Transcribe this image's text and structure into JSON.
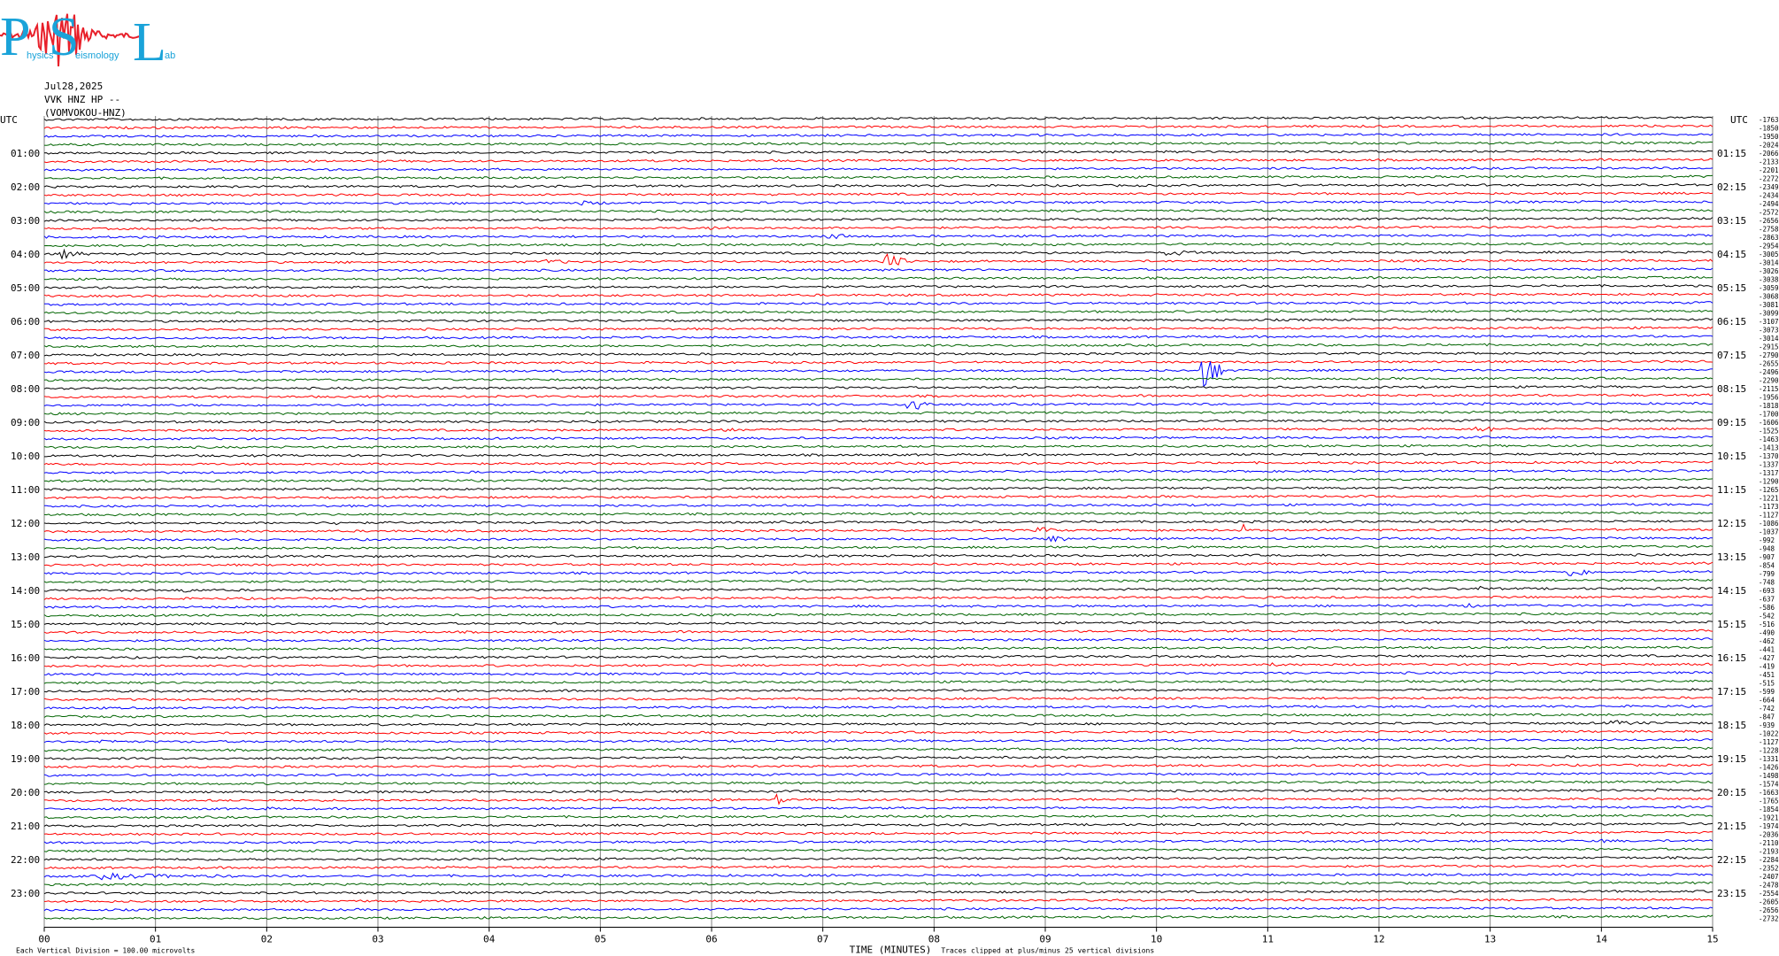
{
  "logo": {
    "letters": [
      "P",
      "S",
      "L"
    ],
    "subtext": [
      "hysics",
      "eismology",
      "ab"
    ],
    "colors": {
      "letters": "#1aa3d9",
      "wave": "#e8202a"
    }
  },
  "header": {
    "date": "Jul28,2025",
    "channel": "VVK HNZ HP --",
    "station": "(VOMVOKOU-HNZ)"
  },
  "chart_data": {
    "type": "line",
    "description_free": true,
    "left_label_header": "UTC",
    "right_label_header": "UTC",
    "left_hours": [
      "01:00",
      "02:00",
      "03:00",
      "04:00",
      "05:00",
      "06:00",
      "07:00",
      "08:00",
      "09:00",
      "10:00",
      "11:00",
      "12:00",
      "13:00",
      "14:00",
      "15:00",
      "16:00",
      "17:00",
      "18:00",
      "19:00",
      "20:00",
      "21:00",
      "22:00",
      "23:00"
    ],
    "right_hours": [
      "01:15",
      "02:15",
      "03:15",
      "04:15",
      "05:15",
      "06:15",
      "07:15",
      "08:15",
      "09:15",
      "10:15",
      "11:15",
      "12:15",
      "13:15",
      "14:15",
      "15:15",
      "16:15",
      "17:15",
      "18:15",
      "19:15",
      "20:15",
      "21:15",
      "22:15",
      "23:15"
    ],
    "right_values": [
      "-1763",
      "-1850",
      "-1950",
      "-2024",
      "-2066",
      "-2133",
      "-2201",
      "-2272",
      "-2349",
      "-2434",
      "-2494",
      "-2572",
      "-2656",
      "-2758",
      "-2863",
      "-2954",
      "-3005",
      "-3014",
      "-3026",
      "-3038",
      "-3059",
      "-3068",
      "-3081",
      "-3099",
      "-3107",
      "-3073",
      "-3014",
      "-2915",
      "-2790",
      "-2655",
      "-2496",
      "-2290",
      "-2115",
      "-1956",
      "-1818",
      "-1700",
      "-1606",
      "-1525",
      "-1463",
      "-1413",
      "-1370",
      "-1337",
      "-1317",
      "-1290",
      "-1265",
      "-1221",
      "-1173",
      "-1127",
      "-1086",
      "-1037",
      "-992",
      "-948",
      "-907",
      "-854",
      "-799",
      "-748",
      "-693",
      "-637",
      "-586",
      "-542",
      "-516",
      "-490",
      "-462",
      "-441",
      "-427",
      "-419",
      "-451",
      "-515",
      "-599",
      "-664",
      "-742",
      "-847",
      "-939",
      "-1022",
      "-1127",
      "-1228",
      "-1331",
      "-1426",
      "-1498",
      "-1574",
      "-1663",
      "-1765",
      "-1854",
      "-1921",
      "-1974",
      "-2036",
      "-2110",
      "-2193",
      "-2284",
      "-2352",
      "-2407",
      "-2478",
      "-2554",
      "-2605",
      "-2656",
      "-2732"
    ],
    "trace_colors": [
      "#000000",
      "#ff0000",
      "#0000ff",
      "#006400"
    ],
    "trace_minutes": 15,
    "traces_count": 96,
    "x_ticks": [
      "00",
      "01",
      "02",
      "03",
      "04",
      "05",
      "06",
      "07",
      "08",
      "09",
      "10",
      "11",
      "12",
      "13",
      "14",
      "15"
    ],
    "xlabel": "TIME (MINUTES)",
    "events": [
      {
        "trace": 16,
        "minute": 0.15,
        "amp": 0.5,
        "dur": 0.25
      },
      {
        "trace": 16,
        "minute": 10.1,
        "amp": 0.4,
        "dur": 0.3
      },
      {
        "trace": 17,
        "minute": 7.55,
        "amp": 1.2,
        "dur": 0.25
      },
      {
        "trace": 17,
        "minute": 4.5,
        "amp": 0.25,
        "dur": 0.3
      },
      {
        "trace": 14,
        "minute": 7.05,
        "amp": 0.35,
        "dur": 0.3
      },
      {
        "trace": 13,
        "minute": 6.0,
        "amp": 0.2,
        "dur": 0.2
      },
      {
        "trace": 10,
        "minute": 4.8,
        "amp": 0.2,
        "dur": 0.3
      },
      {
        "trace": 30,
        "minute": 10.42,
        "amp": 2.5,
        "dur": 0.25
      },
      {
        "trace": 34,
        "minute": 7.78,
        "amp": 1.5,
        "dur": 0.2
      },
      {
        "trace": 37,
        "minute": 12.9,
        "amp": 0.45,
        "dur": 0.2
      },
      {
        "trace": 37,
        "minute": 6.1,
        "amp": 0.2,
        "dur": 0.2
      },
      {
        "trace": 48,
        "minute": 2.6,
        "amp": 0.25,
        "dur": 0.2
      },
      {
        "trace": 49,
        "minute": 8.95,
        "amp": 0.5,
        "dur": 0.15
      },
      {
        "trace": 49,
        "minute": 10.78,
        "amp": 0.6,
        "dur": 0.08
      },
      {
        "trace": 50,
        "minute": 9.05,
        "amp": 0.45,
        "dur": 0.2
      },
      {
        "trace": 51,
        "minute": 10.12,
        "amp": 0.35,
        "dur": 0.1
      },
      {
        "trace": 54,
        "minute": 13.7,
        "amp": 0.6,
        "dur": 0.35
      },
      {
        "trace": 56,
        "minute": 1.25,
        "amp": 0.3,
        "dur": 0.15
      },
      {
        "trace": 56,
        "minute": 12.92,
        "amp": 0.35,
        "dur": 0.1
      },
      {
        "trace": 58,
        "minute": 12.8,
        "amp": 0.2,
        "dur": 0.2
      },
      {
        "trace": 65,
        "minute": 11.0,
        "amp": 0.15,
        "dur": 0.2
      },
      {
        "trace": 72,
        "minute": 14.1,
        "amp": 0.25,
        "dur": 0.3
      },
      {
        "trace": 74,
        "minute": 0.5,
        "amp": 0.2,
        "dur": 0.3
      },
      {
        "trace": 81,
        "minute": 6.6,
        "amp": 1.0,
        "dur": 0.06
      },
      {
        "trace": 80,
        "minute": 14.5,
        "amp": 0.2,
        "dur": 0.2
      },
      {
        "trace": 82,
        "minute": 2.0,
        "amp": 0.15,
        "dur": 0.1
      },
      {
        "trace": 86,
        "minute": 14.0,
        "amp": 0.15,
        "dur": 0.2
      },
      {
        "trace": 90,
        "minute": 0.5,
        "amp": 0.3,
        "dur": 1.2
      }
    ],
    "footer_left": "Each Vertical Division =  100.00 microvolts",
    "footer_right": "Traces clipped at plus/minus 25 vertical divisions"
  }
}
